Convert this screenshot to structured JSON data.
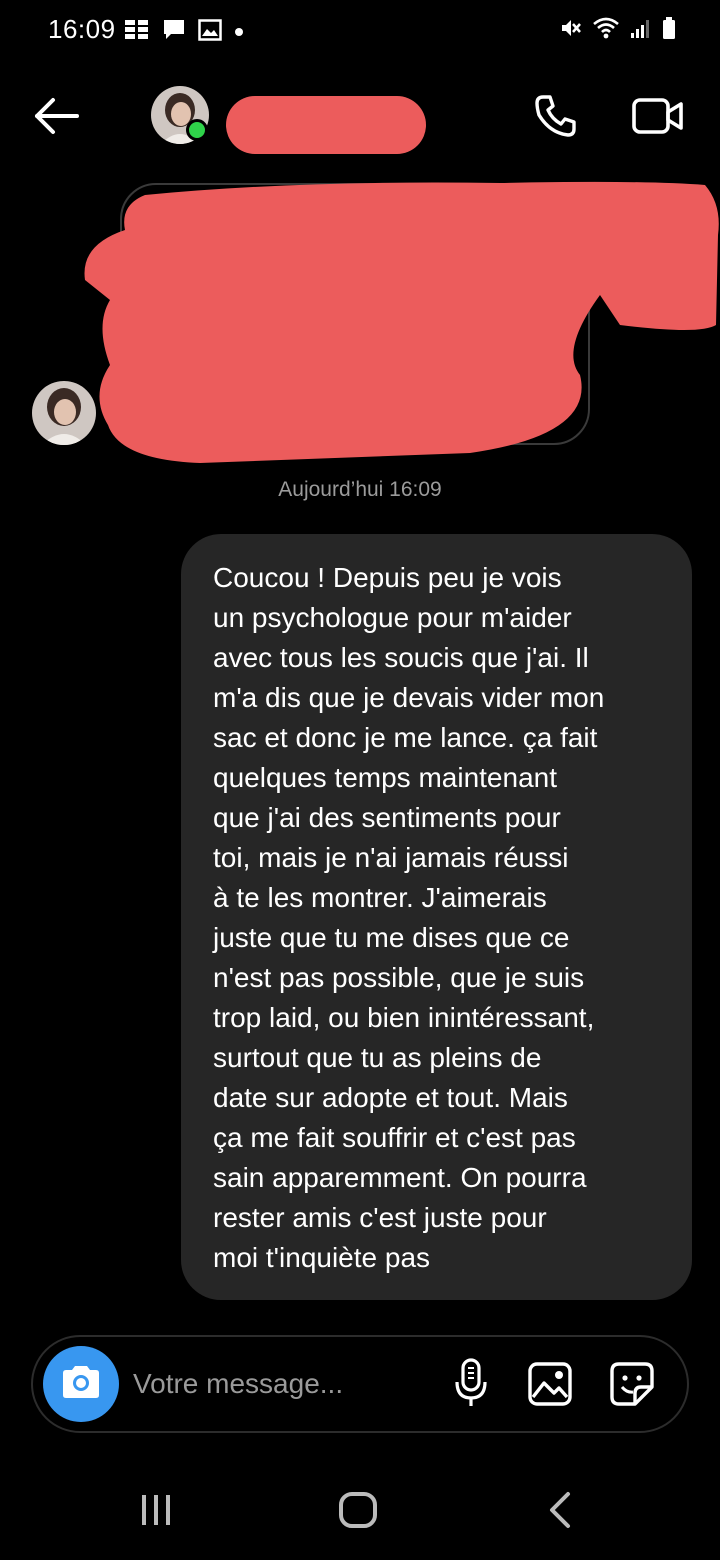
{
  "status_bar": {
    "time": "16:09",
    "left_icons": [
      "grid-notification-icon",
      "chat-notification-icon",
      "image-notification-icon",
      "dot-icon"
    ],
    "right_icons": [
      "mute-icon",
      "wifi-icon",
      "signal-icon",
      "battery-icon"
    ]
  },
  "header": {
    "back_icon": "arrow-left-icon",
    "contact_name": "",
    "online": true,
    "call_icon": "phone-icon",
    "video_icon": "video-camera-icon"
  },
  "conversation": {
    "received_message": {
      "redacted": true,
      "text": ""
    },
    "timestamp": "Aujourd’hui 16:09",
    "sent_message": {
      "text": "Coucou ! Depuis peu je vois\nun psychologue pour m'aider\navec tous les soucis que j'ai. Il\nm'a dis que je devais vider mon\nsac et donc je me lance. ça fait\nquelques temps maintenant\nque j'ai des sentiments pour\ntoi, mais je n'ai jamais réussi\nà te les montrer. J'aimerais\njuste que tu me dises que ce\nn'est pas possible, que je suis\ntrop laid, ou bien inintéressant,\nsurtout que tu as pleins de\ndate sur adopte et tout. Mais\nça me fait souffrir et c'est pas\nsain apparemment. On pourra\nrester amis c'est juste pour\nmoi t'inquiète pas"
    }
  },
  "composer": {
    "placeholder": "Votre message...",
    "value": "",
    "camera_icon": "camera-icon",
    "mic_icon": "microphone-icon",
    "gallery_icon": "image-gallery-icon",
    "sticker_icon": "sticker-icon"
  },
  "nav_bar": {
    "recent_icon": "recent-apps-icon",
    "home_icon": "home-icon",
    "back_icon": "back-chevron-icon"
  },
  "colors": {
    "background": "#000000",
    "bubble": "#262626",
    "accent_blue": "#3897f0",
    "online_green": "#2fd34a",
    "redaction": "#ec5c5c",
    "timestamp_gray": "#9b9b9b"
  }
}
